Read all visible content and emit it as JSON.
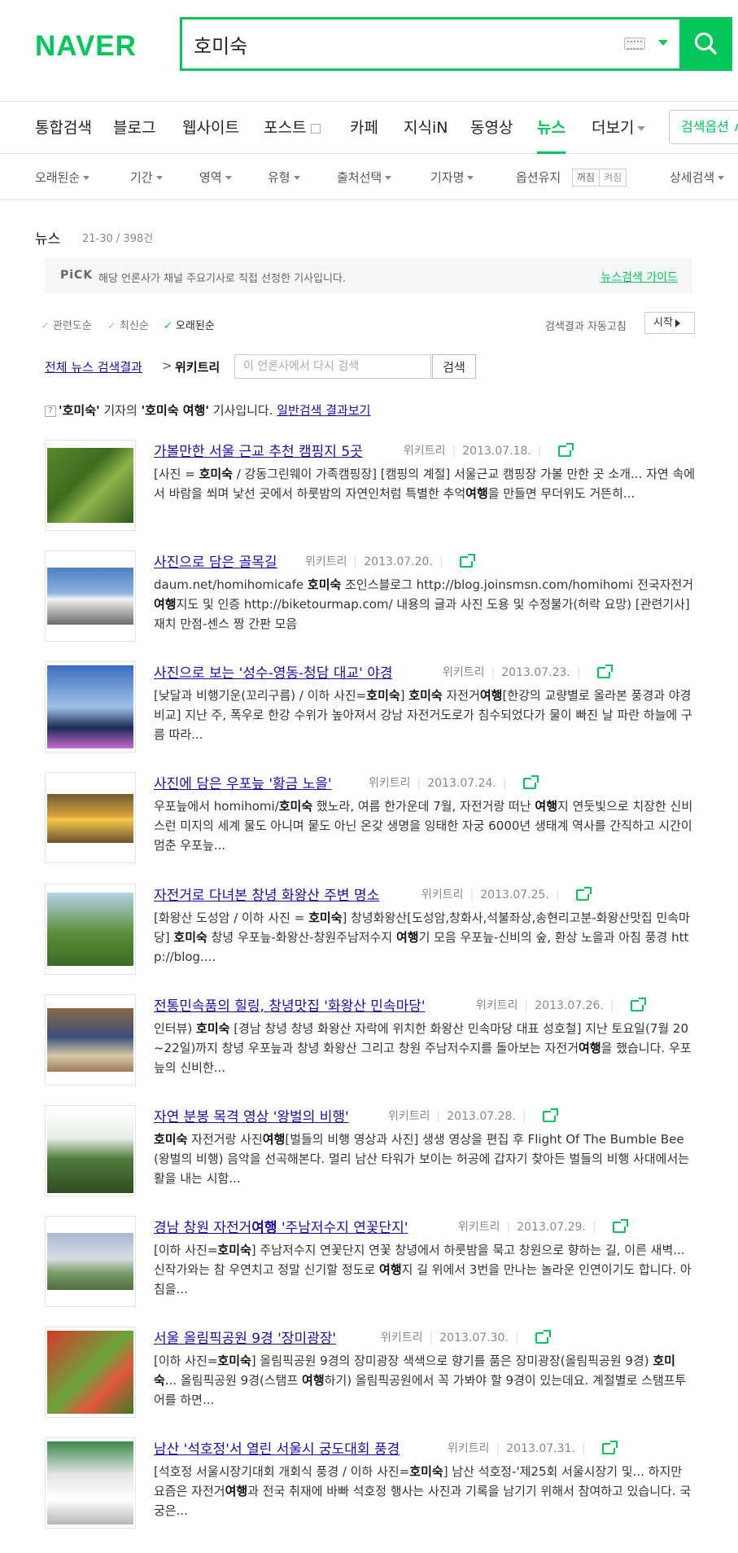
{
  "brand": {
    "logo": "NAVER",
    "accent": "#03c75a",
    "link": "#1a0dab"
  },
  "search": {
    "query": "호미숙"
  },
  "tabs": [
    {
      "label": "통합검색"
    },
    {
      "label": "블로그"
    },
    {
      "label": "웹사이트"
    },
    {
      "label": "포스트"
    },
    {
      "label": "카페"
    },
    {
      "label": "지식iN"
    },
    {
      "label": "동영상"
    },
    {
      "label": "뉴스"
    },
    {
      "label": "더보기"
    }
  ],
  "search_options_label": "검색옵션 ∧",
  "filters": {
    "oldest": "오래된순",
    "period": "기간",
    "area": "영역",
    "type": "유형",
    "source": "출처선택",
    "reporter": "기자명",
    "keep_option": "옵션유지",
    "off": "꺼짐",
    "on": "켜짐",
    "detail": "상세검색"
  },
  "section": {
    "title": "뉴스",
    "count": "21-30 / 398건"
  },
  "pick": {
    "label": "PiCK",
    "text": "해당 언론사가 채널 주요기사로 직접 선정한 기사입니다.",
    "guide": "뉴스검색 가이드"
  },
  "sort": {
    "relevance": "관련도순",
    "latest": "최신순",
    "oldest": "오래된순",
    "auto_refresh": "검색결과 자동고침",
    "start": "시작"
  },
  "breadcrumb": {
    "all": "전체 뉴스 검색결과",
    "sep": ">",
    "press": "위키트리",
    "placeholder": "이 언론사에서 다시 검색",
    "button": "검색"
  },
  "reporter_note": {
    "q": "?",
    "reporter": "'호미숙'",
    "mid": " 기자의 ",
    "keyword": "'호미숙 여행'",
    "suffix": " 기사입니다. ",
    "link": "일반검색 결과보기"
  },
  "results": [
    {
      "title": "가볼만한 서울 근교 추천 캠핑지 5곳",
      "press": "위키트리",
      "date": "2013.07.18.",
      "snippet": "[사진 = 호미숙 / 강동그린웨이 가족캠핑장] [캠핑의 계절] 서울근교 캠핑장 가볼 만한 곳 소개... 자연 속에서 바람을 쐬며 낯선 곳에서 하룻밤의 자연인처럼 특별한 추억여행을 만들면 무더위도 거뜬히..."
    },
    {
      "title": "사진으로 담은 골목길",
      "press": "위키트리",
      "date": "2013.07.20.",
      "snippet": "daum.net/homihomicafe 호미숙 조인스블로그 http://blog.joinsmsn.com/homihomi 전국자전거여행지도 및 인증 http://biketourmap.com/ 내용의 글과 사진 도용 및 수정불가(허락 요망) [관련기사] 재치 만점-센스 짱 간판 모음"
    },
    {
      "title": "사진으로 보는 '성수-영동-청담 대교' 야경",
      "press": "위키트리",
      "date": "2013.07.23.",
      "snippet": "[낮달과 비행기운(꼬리구름) / 이하 사진=호미숙] 호미숙 자전거여행[한강의 교량별로 올라본 풍경과 야경 비교] 지난 주, 폭우로 한강 수위가 높아져서 강남 자전거도로가 침수되었다가 물이 빠진 날 파란 하늘에 구름 따라..."
    },
    {
      "title": "사진에 담은 우포늪 '황금 노을'",
      "press": "위키트리",
      "date": "2013.07.24.",
      "snippet": "우포늪에서 homihomi/호미숙 했노라, 여름 한가운데 7월, 자전거랑 떠난 여행지 연둣빛으로 치장한 신비스런 미지의 세계 물도 아니며 뭍도 아닌 온갖 생명을 잉태한 자궁 6000년 생태계 역사를 간직하고 시간이 멈춘 우포늪..."
    },
    {
      "title": "자전거로 다녀본 창녕 화왕산 주변 명소",
      "press": "위키트리",
      "date": "2013.07.25.",
      "snippet": "[화왕산 도성암 / 이하 사진 = 호미숙] 창녕화왕산[도성암,창화사,석불좌상,송현리고분-화왕산맛집 민속마당] 호미숙 창녕 우포늪-화왕산-창원주남저수지 여행기 모음 우포늪-신비의 숲, 환상 노을과 아침 풍경 http://blog...."
    },
    {
      "title": "전통민속품의 힐링, 창녕맛집 '화왕산 민속마당'",
      "press": "위키트리",
      "date": "2013.07.26.",
      "snippet": "인터뷰) 호미숙 [경남 창녕 창녕 화왕산 자락에 위치한 화왕산 민속마당 대표 성호철] 지난 토요일(7월 20~22일)까지 창녕 우포늪과 창녕 화왕산 그리고 창원 주남저수지를 돌아보는 자전거여행을 했습니다. 우포늪의 신비한..."
    },
    {
      "title": "자연 분봉 목격 영상 '왕벌의 비행'",
      "press": "위키트리",
      "date": "2013.07.28.",
      "snippet": "호미숙 자전거랑 사진여행[벌들의 비행 영상과 사진] 생생 영상을 편집 후 Flight Of The Bumble Bee(왕벌의 비행) 음악을 선곡해본다. 멀리 남산 타워가 보이는 허공에 갑자기 찾아든 벌들의 비행 사대에서는 활을 내는 시함..."
    },
    {
      "title": "경남 창원 자전거여행 '주남저수지 연꽃단지'",
      "press": "위키트리",
      "date": "2013.07.29.",
      "snippet": "[이하 사진=호미숙] 주남저수지 연꽃단지 연꽃 창녕에서 하룻밤을 묵고 창원으로 향하는 길, 이른 새벽... 신작가와는 참 우연치고 정말 신기할 정도로 여행지 길 위에서 3번을 만나는 놀라운 인연이기도 합니다. 아침을..."
    },
    {
      "title": "서울 올림픽공원 9경 '장미광장'",
      "press": "위키트리",
      "date": "2013.07.30.",
      "snippet": "[이하 사진=호미숙] 올림픽공원 9경의 장미광장 색색으로 향기를 품은 장미광장(올림픽공원 9경) 호미숙... 올림픽공원 9경(스탬프 여행하기) 올림픽공원에서 꼭 가봐야 할 9경이 있는데요. 계절별로 스탬프투어를 하면..."
    },
    {
      "title": "남산 '석호정'서 열린 서울시 궁도대회 풍경",
      "press": "위키트리",
      "date": "2013.07.31.",
      "snippet": "[석호정 서울시장기대회 개회식 풍경 / 이하 사진=호미숙] 남산 석호정-'제25회 서울시장기 및... 하지만 요즘은 자전거여행과 전국 취재에 바빠 석호정 행사는 사진과 기록을 남기기 위해서 참여하고 있습니다. 국궁은..."
    }
  ]
}
